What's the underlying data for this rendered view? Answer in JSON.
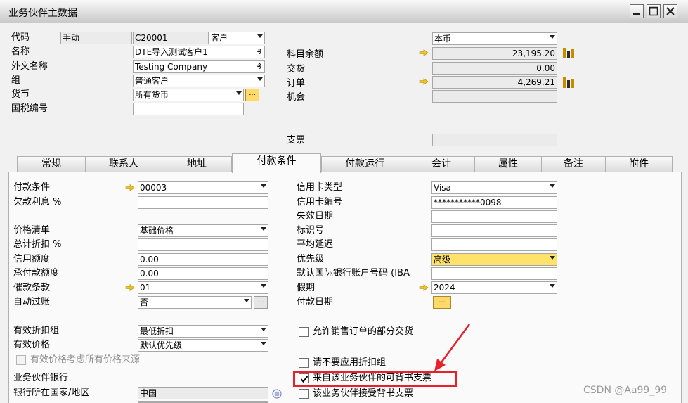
{
  "window": {
    "title": "业务伙伴主数据",
    "controls": [
      "minimize-icon",
      "maximize-icon",
      "close-icon"
    ]
  },
  "header": {
    "code_label": "代码",
    "code_mode": "手动",
    "code_value": "C20001",
    "type_value": "客户",
    "name_label": "名称",
    "name_value": "DTE导入测试客户1",
    "foreign_name_label": "外文名称",
    "foreign_name_value": "Testing Company",
    "group_label": "组",
    "group_value": "普通客户",
    "currency_label": "货币",
    "currency_value": "所有货币",
    "tax_id_label": "国税编号",
    "tax_id_value": "",
    "currency_display_value": "本币",
    "account_balance_label": "科目余额",
    "account_balance_value": "23,195.20",
    "deliveries_label": "交货",
    "deliveries_value": "0.00",
    "orders_label": "订单",
    "orders_value": "4,269.21",
    "opportunities_label": "机会",
    "opportunities_value": "",
    "checks_label": "支票",
    "checks_value": "",
    "ellipsis": "..."
  },
  "tabs": [
    {
      "label": "常规",
      "active": false
    },
    {
      "label": "联系人",
      "active": false
    },
    {
      "label": "地址",
      "active": false
    },
    {
      "label": "付款条件",
      "active": true
    },
    {
      "label": "付款运行",
      "active": false
    },
    {
      "label": "会计",
      "active": false
    },
    {
      "label": "属性",
      "active": false
    },
    {
      "label": "备注",
      "active": false
    },
    {
      "label": "附件",
      "active": false
    }
  ],
  "payment_terms": {
    "terms_label": "付款条件",
    "terms_value": "00003",
    "interest_label": "欠款利息 %",
    "interest_value": "",
    "price_list_label": "价格清单",
    "price_list_value": "基础价格",
    "total_discount_label": "总计折扣 %",
    "total_discount_value": "",
    "credit_limit_label": "信用额度",
    "credit_limit_value": "0.00",
    "commitment_limit_label": "承付款额度",
    "commitment_limit_value": "0.00",
    "dunning_label": "催款条款",
    "dunning_value": "01",
    "auto_post_label": "自动过账",
    "auto_post_value": "否",
    "discount_group_label": "有效折扣组",
    "discount_group_value": "最低折扣",
    "effective_price_label": "有效价格",
    "effective_price_value": "默认优先级",
    "all_price_sources_label": "有效价格考虑所有价格来源",
    "all_price_sources_checked": false,
    "bp_bank_heading": "业务伙伴银行",
    "bank_country_label": "银行所在国家/地区",
    "bank_country_value": "中国",
    "card_type_label": "信用卡类型",
    "card_type_value": "Visa",
    "card_number_label": "信用卡编号",
    "card_number_value": "***********0098",
    "expiry_label": "失效日期",
    "expiry_value": "",
    "id_number_label": "标识号",
    "id_number_value": "",
    "avg_delay_label": "平均延迟",
    "avg_delay_value": "",
    "priority_label": "优先级",
    "priority_value": "高级",
    "default_iban_label": "默认国际银行账户号码 (IBA",
    "default_iban_value": "",
    "holidays_label": "假期",
    "holidays_value": "2024",
    "payment_dates_label": "付款日期",
    "partial_delivery_label": "允许销售订单的部分交货",
    "partial_delivery_checked": false,
    "no_discount_label": "请不要应用折扣组",
    "no_discount_checked": false,
    "endorsable_from_label": "来自该业务伙伴的可背书支票",
    "endorsable_from_checked": true,
    "accepts_endorsed_label": "该业务伙伴接受背书支票",
    "accepts_endorsed_checked": false
  },
  "watermark": "CSDN @Aa99_99",
  "colors": {
    "highlight_box": "#e8202a",
    "annotation_arrow": "#e8202a",
    "field_highlight": "#ffe26a",
    "link_arrow": "#f0c419"
  }
}
